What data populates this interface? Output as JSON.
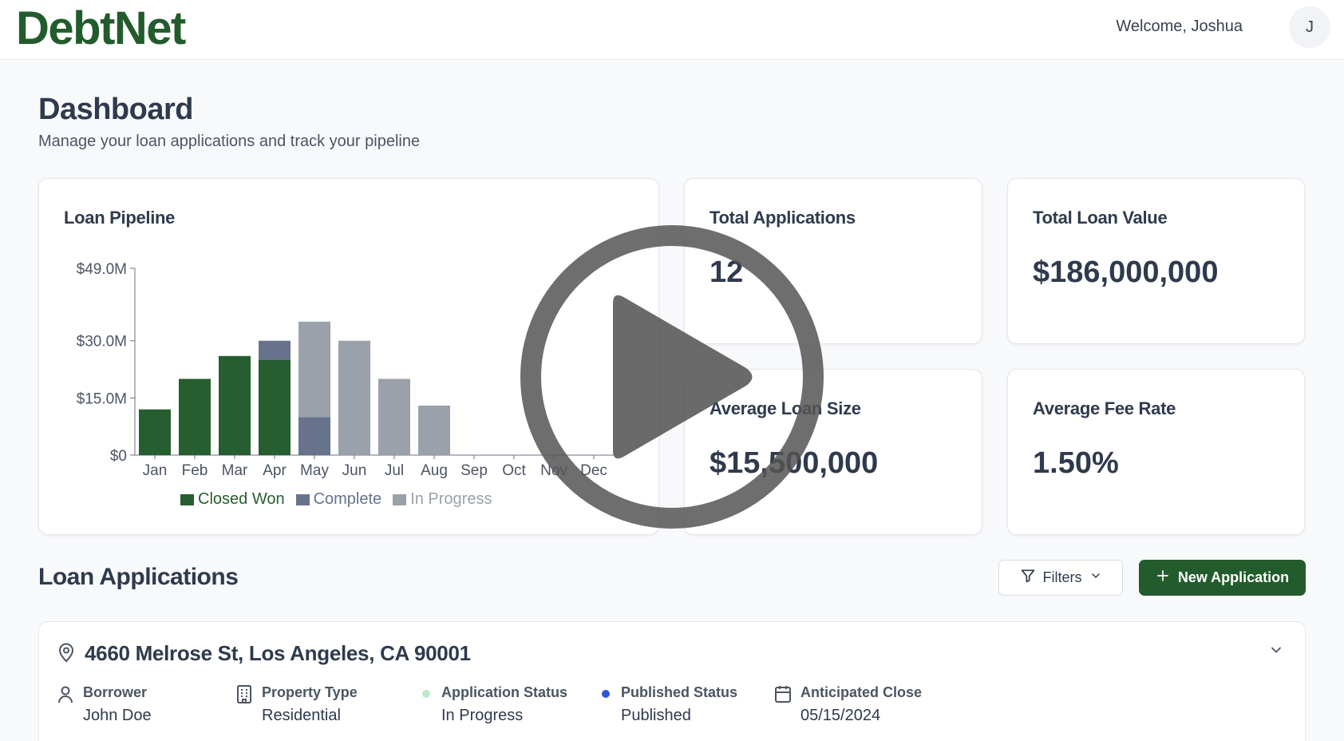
{
  "header": {
    "logo": "DebtNet",
    "welcome": "Welcome, Joshua",
    "avatar_initial": "J"
  },
  "page": {
    "title": "Dashboard",
    "subtitle": "Manage your loan applications and track your pipeline"
  },
  "pipeline_card": {
    "title": "Loan Pipeline"
  },
  "chart_data": {
    "type": "bar",
    "title": "Loan Pipeline",
    "stacked": true,
    "categories": [
      "Jan",
      "Feb",
      "Mar",
      "Apr",
      "May",
      "Jun",
      "Jul",
      "Aug",
      "Sep",
      "Oct",
      "Nov",
      "Dec"
    ],
    "y_ticks": [
      "$0",
      "$15.0M",
      "$30.0M",
      "$49.0M"
    ],
    "ylim": [
      0,
      49
    ],
    "series": [
      {
        "name": "Closed Won",
        "color": "#265e2f",
        "values": [
          12,
          20,
          26,
          25,
          0,
          0,
          0,
          0,
          0,
          0,
          0,
          0
        ]
      },
      {
        "name": "Complete",
        "color": "#67738d",
        "values": [
          0,
          0,
          0,
          5,
          10,
          0,
          0,
          0,
          0,
          0,
          0,
          0
        ]
      },
      {
        "name": "In Progress",
        "color": "#9ba1ab",
        "values": [
          0,
          0,
          0,
          0,
          25,
          30,
          20,
          13,
          0,
          0,
          0,
          0
        ]
      }
    ],
    "legend_position": "bottom"
  },
  "kpis": {
    "total_applications": {
      "label": "Total Applications",
      "value": "12"
    },
    "total_loan_value": {
      "label": "Total Loan Value",
      "value": "$186,000,000"
    },
    "average_loan_size": {
      "label": "Average Loan Size",
      "value": "$15,500,000"
    },
    "average_fee_rate": {
      "label": "Average Fee Rate",
      "value": "1.50%"
    }
  },
  "applications": {
    "section_title": "Loan Applications",
    "filters_label": "Filters",
    "new_label": "New Application",
    "items": [
      {
        "address": "4660 Melrose St, Los Angeles, CA 90001",
        "borrower_label": "Borrower",
        "borrower": "John Doe",
        "property_type_label": "Property Type",
        "property_type": "Residential",
        "application_status_label": "Application Status",
        "application_status": "In Progress",
        "published_status_label": "Published Status",
        "published_status": "Published",
        "anticipated_close_label": "Anticipated Close",
        "anticipated_close": "05/15/2024"
      }
    ]
  },
  "colors": {
    "brand": "#235c2c",
    "application_status_dot": "#bfe9c8",
    "published_status_dot": "#2f55d4"
  }
}
